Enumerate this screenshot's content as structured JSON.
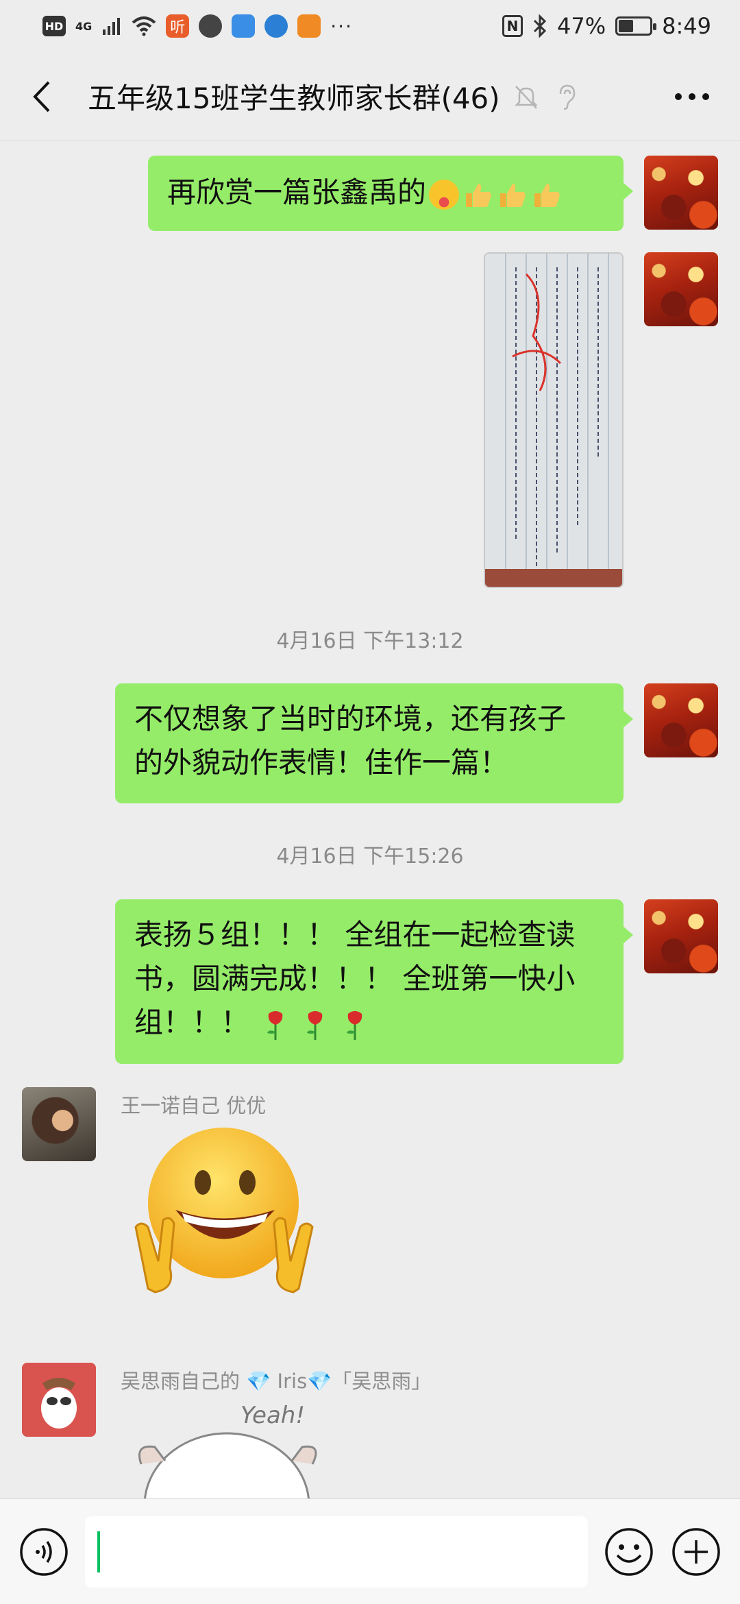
{
  "status_bar": {
    "hd": "HD",
    "network": "4G",
    "listen_app": "听",
    "nfc": "N",
    "battery": "47%",
    "battery_level": 0.47,
    "time": "8:49",
    "more": "···"
  },
  "header": {
    "title": "五年级15班学生教师家长群(46)"
  },
  "messages": [
    {
      "type": "text",
      "side": "right",
      "text": "再欣赏一篇张鑫禹的"
    },
    {
      "type": "image",
      "side": "right"
    },
    {
      "type": "time",
      "text": "4月16日 下午13:12"
    },
    {
      "type": "text",
      "side": "right",
      "lines": [
        "不仅想象了当时的环境，还有孩子",
        "的外貌动作表情！佳作一篇！"
      ]
    },
    {
      "type": "time",
      "text": "4月16日 下午15:26"
    },
    {
      "type": "text",
      "side": "right",
      "lines": [
        "表扬５组！！！ 全组在一起检查读",
        "书，圆满完成！！！ 全班第一快小",
        "组！！！"
      ]
    },
    {
      "type": "sticker",
      "side": "left",
      "sender": "王一诺自己 优优"
    },
    {
      "type": "sticker",
      "side": "left",
      "sender": "吴思雨自己的 💎 Iris💎「吴思雨」",
      "caption": "Yeah!"
    }
  ],
  "input": {
    "placeholder": ""
  },
  "colors": {
    "bubble_green": "#95ec69",
    "background": "#ededed",
    "cursor": "#07c160"
  },
  "icons": {
    "back": "back-arrow-icon",
    "mute": "bell-muted-icon",
    "ear": "ear-icon",
    "more": "more-dots-icon",
    "voice": "voice-icon",
    "emoji": "emoji-icon",
    "add": "plus-icon"
  }
}
